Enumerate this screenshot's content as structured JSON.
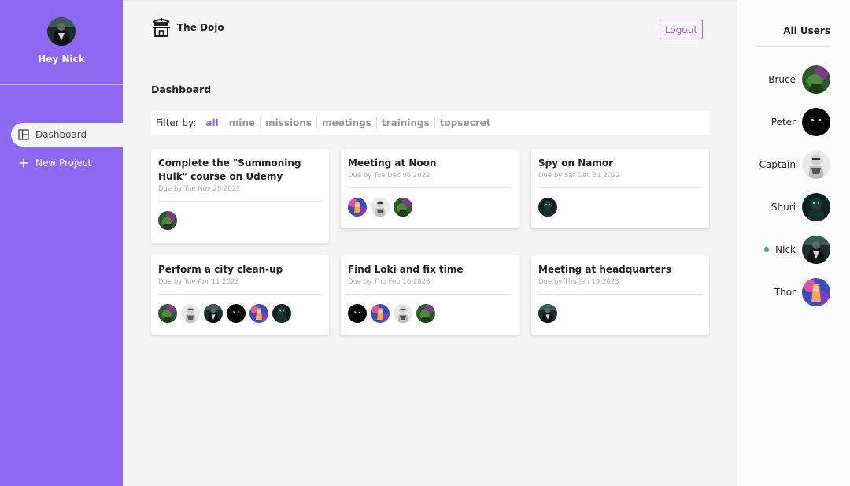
{
  "sidebar": {
    "greeting": "Hey Nick",
    "nav": [
      {
        "label": "Dashboard",
        "icon": "dashboard-icon"
      },
      {
        "label": "New Project",
        "icon": "plus-icon"
      }
    ]
  },
  "header": {
    "brand": "The Dojo",
    "logout_label": "Logout"
  },
  "main": {
    "title": "Dashboard",
    "filter": {
      "label": "Filter by:",
      "options": [
        "all",
        "mine",
        "missions",
        "meetings",
        "trainings",
        "topsecret"
      ],
      "active": "all"
    },
    "projects": [
      {
        "title": "Complete the \"Summoning Hulk\" course on Udemy",
        "due": "Due by Tue Nov 29 2022",
        "assigned": [
          "bruce"
        ]
      },
      {
        "title": "Meeting at Noon",
        "due": "Due by Tue Dec 06 2022",
        "assigned": [
          "thor",
          "captain",
          "bruce"
        ]
      },
      {
        "title": "Spy on Namor",
        "due": "Due by Sat Dec 31 2022",
        "assigned": [
          "shuri"
        ]
      },
      {
        "title": "Perform a city clean-up",
        "due": "Due by Tue Apr 11 2023",
        "assigned": [
          "bruce",
          "captain",
          "nick",
          "peter",
          "thor",
          "shuri"
        ]
      },
      {
        "title": "Find Loki and fix time",
        "due": "Due by Thu Feb 16 2023",
        "assigned": [
          "peter",
          "thor",
          "captain",
          "bruce"
        ]
      },
      {
        "title": "Meeting at headquarters",
        "due": "Due by Thu Jan 19 2023",
        "assigned": [
          "nick"
        ]
      }
    ]
  },
  "users": {
    "title": "All Users",
    "list": [
      {
        "name": "Bruce",
        "online": false
      },
      {
        "name": "Peter",
        "online": false
      },
      {
        "name": "Captain",
        "online": false
      },
      {
        "name": "Shuri",
        "online": false
      },
      {
        "name": "Nick",
        "online": true
      },
      {
        "name": "Thor",
        "online": false
      }
    ]
  },
  "colors": {
    "accent": "#8d69f1",
    "online": "#0ebb50",
    "background": "#f4f4f4"
  }
}
